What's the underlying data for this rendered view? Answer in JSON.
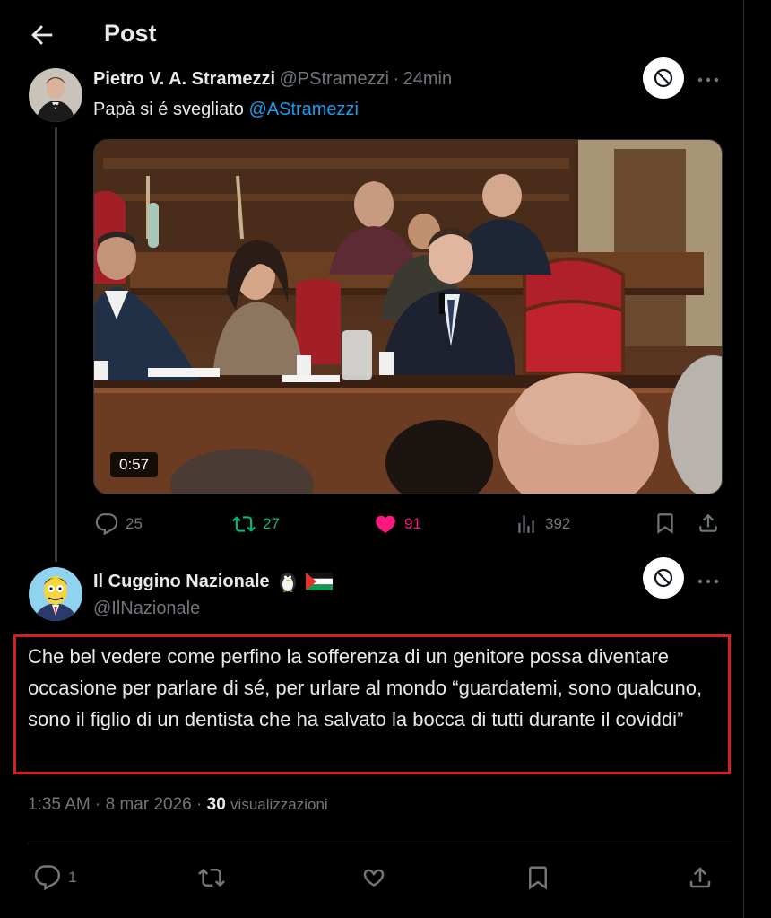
{
  "header": {
    "title": "Post"
  },
  "original_post": {
    "author_name": "Pietro V. A. Stramezzi",
    "author_handle": "@PStramezzi",
    "separator": "·",
    "time": "24min",
    "text_main": "Papà si é svegliato ",
    "text_mention": "@AStramezzi",
    "video_duration": "0:57",
    "stats": {
      "replies": "25",
      "reposts": "27",
      "likes": "91",
      "views": "392"
    }
  },
  "reply_post": {
    "author_name": "Il Cuggino Nazionale",
    "author_handle": "@IlNazionale",
    "text": "Che bel vedere come perfino la sofferenza di un genitore possa diventare occasione per parlare di sé, per urlare al mondo “guardatemi, sono qualcuno, sono il figlio di un dentista che ha salvato la bocca di tutti durante il coviddi”",
    "time": "1:35 AM",
    "date": "8 mar 2026",
    "views_count": "30",
    "views_label": "visualizzazioni",
    "meta_sep": "·",
    "stats": {
      "replies": "1"
    }
  },
  "colors": {
    "accent": "#1d9bf0",
    "repost": "#00ba7c",
    "like": "#f91880",
    "muted": "#71767b",
    "highlight_border": "#d81e1e"
  },
  "icons": [
    "back-arrow-icon",
    "block-icon",
    "more-icon",
    "reply-icon",
    "repost-icon",
    "heart-icon",
    "views-icon",
    "bookmark-icon",
    "share-icon",
    "penguin-emoji",
    "palestine-flag-emoji"
  ]
}
